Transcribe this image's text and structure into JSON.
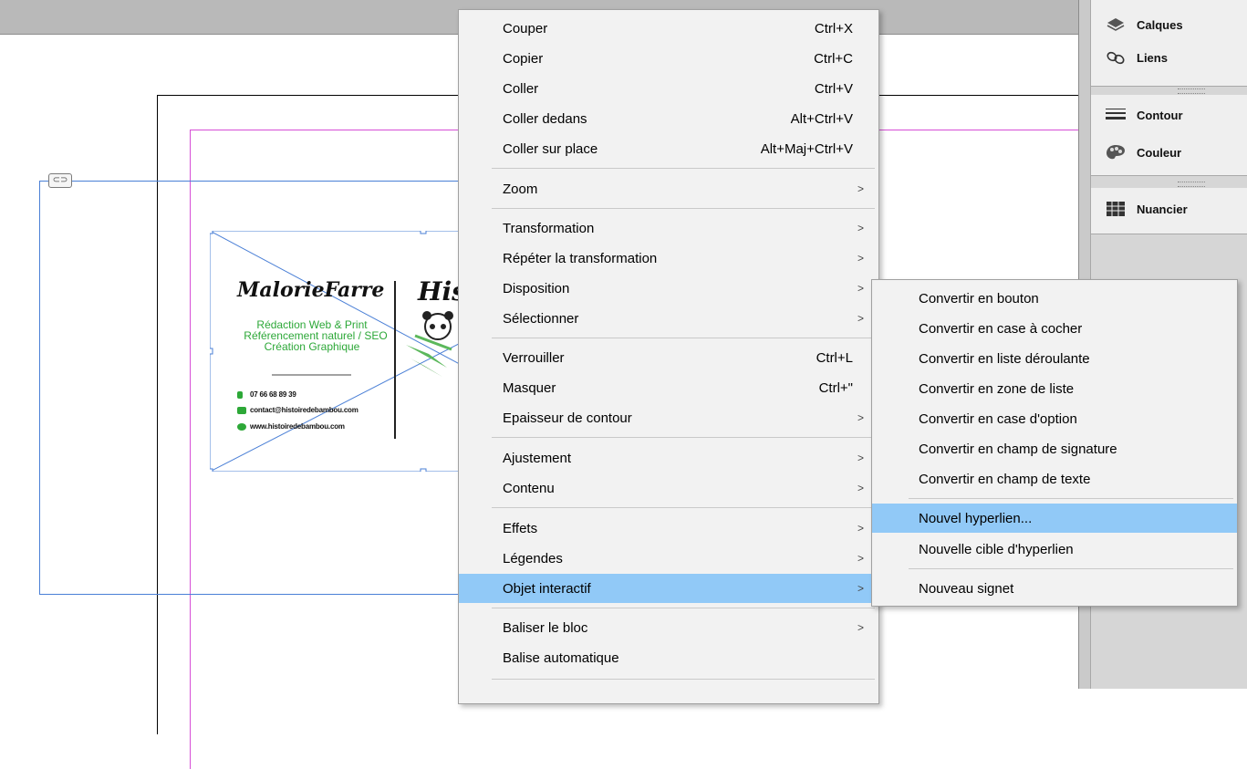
{
  "main_menu": {
    "items": [
      {
        "label": "Couper",
        "shortcut": "Ctrl+X"
      },
      {
        "label": "Copier",
        "shortcut": "Ctrl+C"
      },
      {
        "label": "Coller",
        "shortcut": "Ctrl+V"
      },
      {
        "label": "Coller dedans",
        "shortcut": "Alt+Ctrl+V"
      },
      {
        "label": "Coller sur place",
        "shortcut": "Alt+Maj+Ctrl+V"
      },
      {
        "label": "Zoom",
        "submenu": true
      },
      {
        "label": "Transformation",
        "submenu": true
      },
      {
        "label": "Répéter la transformation",
        "submenu": true
      },
      {
        "label": "Disposition",
        "submenu": true
      },
      {
        "label": "Sélectionner",
        "submenu": true
      },
      {
        "label": "Verrouiller",
        "shortcut": "Ctrl+L"
      },
      {
        "label": "Masquer",
        "shortcut": "Ctrl+\""
      },
      {
        "label": "Epaisseur de contour",
        "submenu": true
      },
      {
        "label": "Ajustement",
        "submenu": true
      },
      {
        "label": "Contenu",
        "submenu": true
      },
      {
        "label": "Effets",
        "submenu": true
      },
      {
        "label": "Légendes",
        "submenu": true
      },
      {
        "label": "Objet interactif",
        "submenu": true,
        "highlighted": true
      },
      {
        "label": "Baliser le bloc",
        "submenu": true
      },
      {
        "label": "Balise automatique"
      }
    ],
    "submenu_arrow": ">"
  },
  "sub_menu": {
    "items": [
      {
        "label": "Convertir en bouton"
      },
      {
        "label": "Convertir en case à cocher"
      },
      {
        "label": "Convertir en liste déroulante"
      },
      {
        "label": "Convertir en zone de liste"
      },
      {
        "label": "Convertir en case d'option"
      },
      {
        "label": "Convertir en champ de signature"
      },
      {
        "label": "Convertir en champ de texte"
      },
      {
        "label": "Nouvel hyperlien...",
        "highlighted": true
      },
      {
        "label": "Nouvelle cible d'hyperlien"
      },
      {
        "label": "Nouveau signet"
      }
    ]
  },
  "panel": {
    "items": [
      {
        "label": "Calques",
        "icon": "layers-icon"
      },
      {
        "label": "Liens",
        "icon": "links-icon"
      },
      {
        "label": "Contour",
        "icon": "stroke-icon"
      },
      {
        "label": "Couleur",
        "icon": "color-palette-icon"
      },
      {
        "label": "Nuancier",
        "icon": "swatches-icon"
      }
    ]
  },
  "card": {
    "name": "MalorieFarre",
    "brand": "His",
    "services": [
      "Rédaction Web & Print",
      "Référencement naturel / SEO",
      "Création Graphique"
    ],
    "phone": "07 66 68 89 39",
    "email": "contact@histoiredebambou.com",
    "website": "www.histoiredebambou.com"
  },
  "colors": {
    "menu_highlight": "#91c9f7",
    "frame_blue": "#4a7fd6",
    "margin_magenta": "#d64ed6",
    "card_green": "#2da838"
  }
}
